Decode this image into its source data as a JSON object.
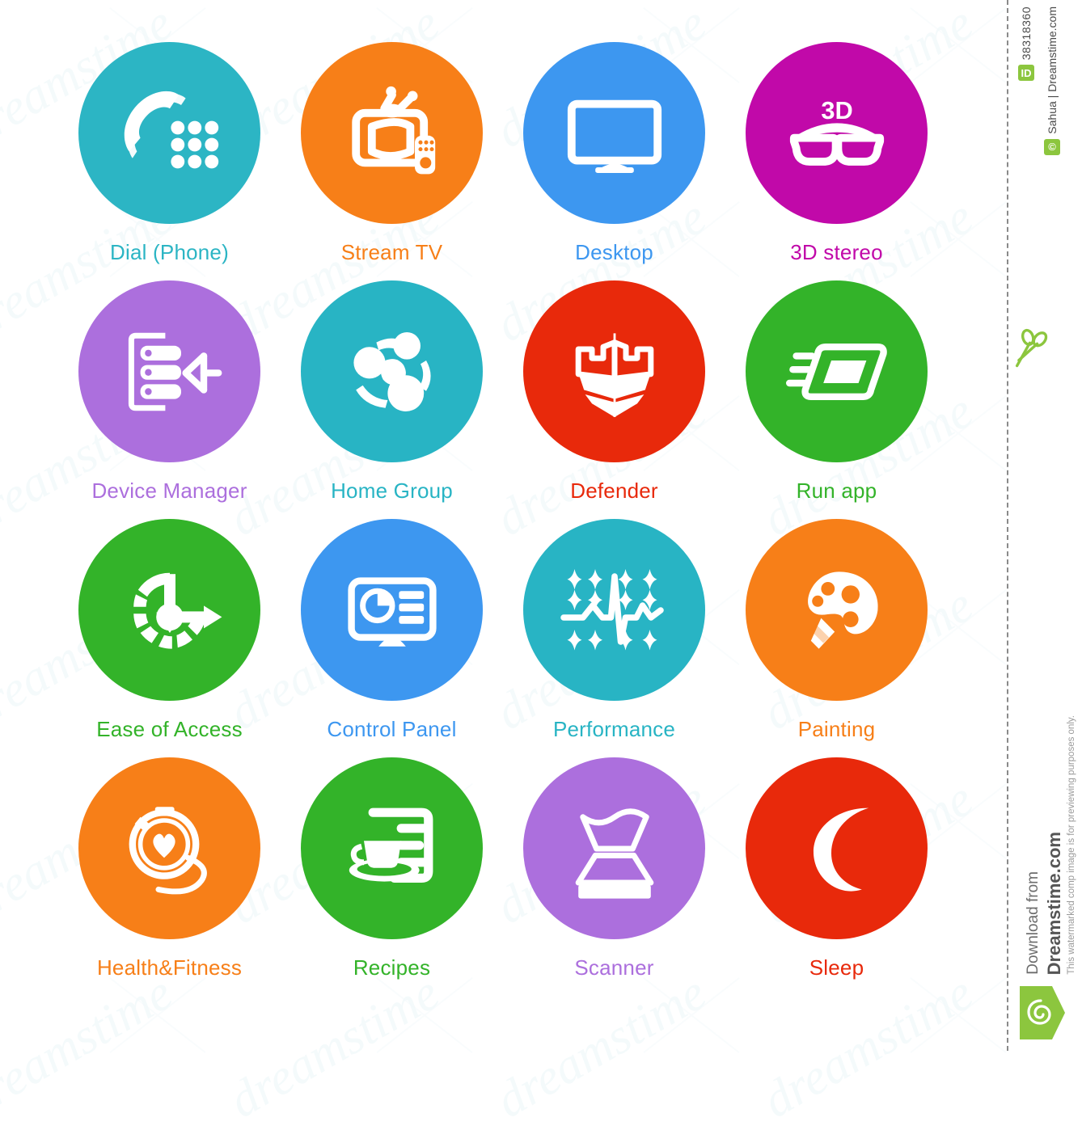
{
  "sheet": {
    "icons": [
      {
        "label": "Dial (Phone)",
        "icon": "phone-dial-icon",
        "color": "#2cb5c4",
        "text_color": "#2cb5c4"
      },
      {
        "label": "Stream TV",
        "icon": "television-icon",
        "color": "#f77f18",
        "text_color": "#f77f18"
      },
      {
        "label": "Desktop",
        "icon": "monitor-icon",
        "color": "#3d97f0",
        "text_color": "#3d97f0"
      },
      {
        "label": "3D stereo",
        "icon": "3d-glasses-icon",
        "color": "#c109a9",
        "text_color": "#c109a9"
      },
      {
        "label": "Device Manager",
        "icon": "server-rack-icon",
        "color": "#ac6fdd",
        "text_color": "#ac6fdd"
      },
      {
        "label": "Home Group",
        "icon": "people-group-icon",
        "color": "#28b4c4",
        "text_color": "#28b4c4"
      },
      {
        "label": "Defender",
        "icon": "castle-shield-icon",
        "color": "#e8290b",
        "text_color": "#e8290b"
      },
      {
        "label": "Run app",
        "icon": "running-window-icon",
        "color": "#33b329",
        "text_color": "#33b329"
      },
      {
        "label": "Ease of Access",
        "icon": "accessibility-icon",
        "color": "#33b329",
        "text_color": "#33b329"
      },
      {
        "label": "Control Panel",
        "icon": "dashboard-icon",
        "color": "#3d97f0",
        "text_color": "#3d97f0"
      },
      {
        "label": "Performance",
        "icon": "pulse-graph-icon",
        "color": "#28b4c4",
        "text_color": "#28b4c4"
      },
      {
        "label": "Painting",
        "icon": "palette-brush-icon",
        "color": "#f77f18",
        "text_color": "#f77f18"
      },
      {
        "label": "Health&Fitness",
        "icon": "stopwatch-heart-icon",
        "color": "#f77f18",
        "text_color": "#f77f18"
      },
      {
        "label": "Recipes",
        "icon": "coffee-cup-icon",
        "color": "#33b329",
        "text_color": "#33b329"
      },
      {
        "label": "Scanner",
        "icon": "flatbed-scanner-icon",
        "color": "#ac6fdd",
        "text_color": "#ac6fdd"
      },
      {
        "label": "Sleep",
        "icon": "crescent-moon-icon",
        "color": "#e8290b",
        "text_color": "#e8290b"
      }
    ],
    "watermark_text": "dreamstime"
  },
  "rail": {
    "id_badge": "ID",
    "id_number": "38318360",
    "copyright_badge": "©",
    "credit": "Sahua | Dreamstime.com",
    "download_from": "Download from",
    "site": "Dreamstime.com",
    "disclaimer": "This watermarked comp image is for previewing purposes only.",
    "accent_color": "#8cc63e"
  }
}
